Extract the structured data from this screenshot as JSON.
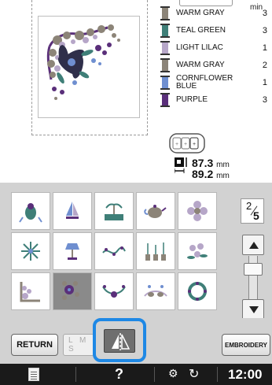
{
  "thread_list": {
    "min_label": "min",
    "items": [
      {
        "name": "WARM GRAY",
        "minutes": "3",
        "color": "#8c8478"
      },
      {
        "name": "TEAL GREEN",
        "minutes": "3",
        "color": "#3f7f78"
      },
      {
        "name": "LIGHT LILAC",
        "minutes": "1",
        "color": "#b6a6c8"
      },
      {
        "name": "WARM GRAY",
        "minutes": "2",
        "color": "#8c8478"
      },
      {
        "name": "CORNFLOWER BLUE",
        "minutes": "1",
        "color": "#6f8fd0"
      },
      {
        "name": "PURPLE",
        "minutes": "3",
        "color": "#5a2f7a"
      }
    ]
  },
  "dimensions": {
    "width_value": "87.3",
    "height_value": "89.2",
    "unit": "mm"
  },
  "pager": {
    "current": "2",
    "total": "5"
  },
  "buttons": {
    "return_label": "RETURN",
    "size_label": "L M S",
    "embroidery_label": "EMBROIDERY"
  },
  "status": {
    "help": "?",
    "time": "12:00"
  },
  "patterns": [
    {
      "icon": "parrot-pattern-icon"
    },
    {
      "icon": "sailboat-pattern-icon"
    },
    {
      "icon": "beach-palm-pattern-icon"
    },
    {
      "icon": "teapot-pattern-icon"
    },
    {
      "icon": "lace-flower-pattern-icon"
    },
    {
      "icon": "snowflake-pattern-icon"
    },
    {
      "icon": "lamp-pattern-icon"
    },
    {
      "icon": "vine-border-pattern-icon"
    },
    {
      "icon": "plant-pots-pattern-icon"
    },
    {
      "icon": "floral-spray-pattern-icon"
    },
    {
      "icon": "corner-scroll-pattern-icon"
    },
    {
      "icon": "corner-floral-pattern-icon"
    },
    {
      "icon": "swag-border-pattern-icon"
    },
    {
      "icon": "cats-pattern-icon"
    },
    {
      "icon": "wreath-pattern-icon"
    }
  ],
  "colors": {
    "panel_gray": "#d2d2d2",
    "highlight_blue": "#1e88e5",
    "status_bar": "#1a1a1a",
    "selected_cell": "#8a8a8a"
  }
}
